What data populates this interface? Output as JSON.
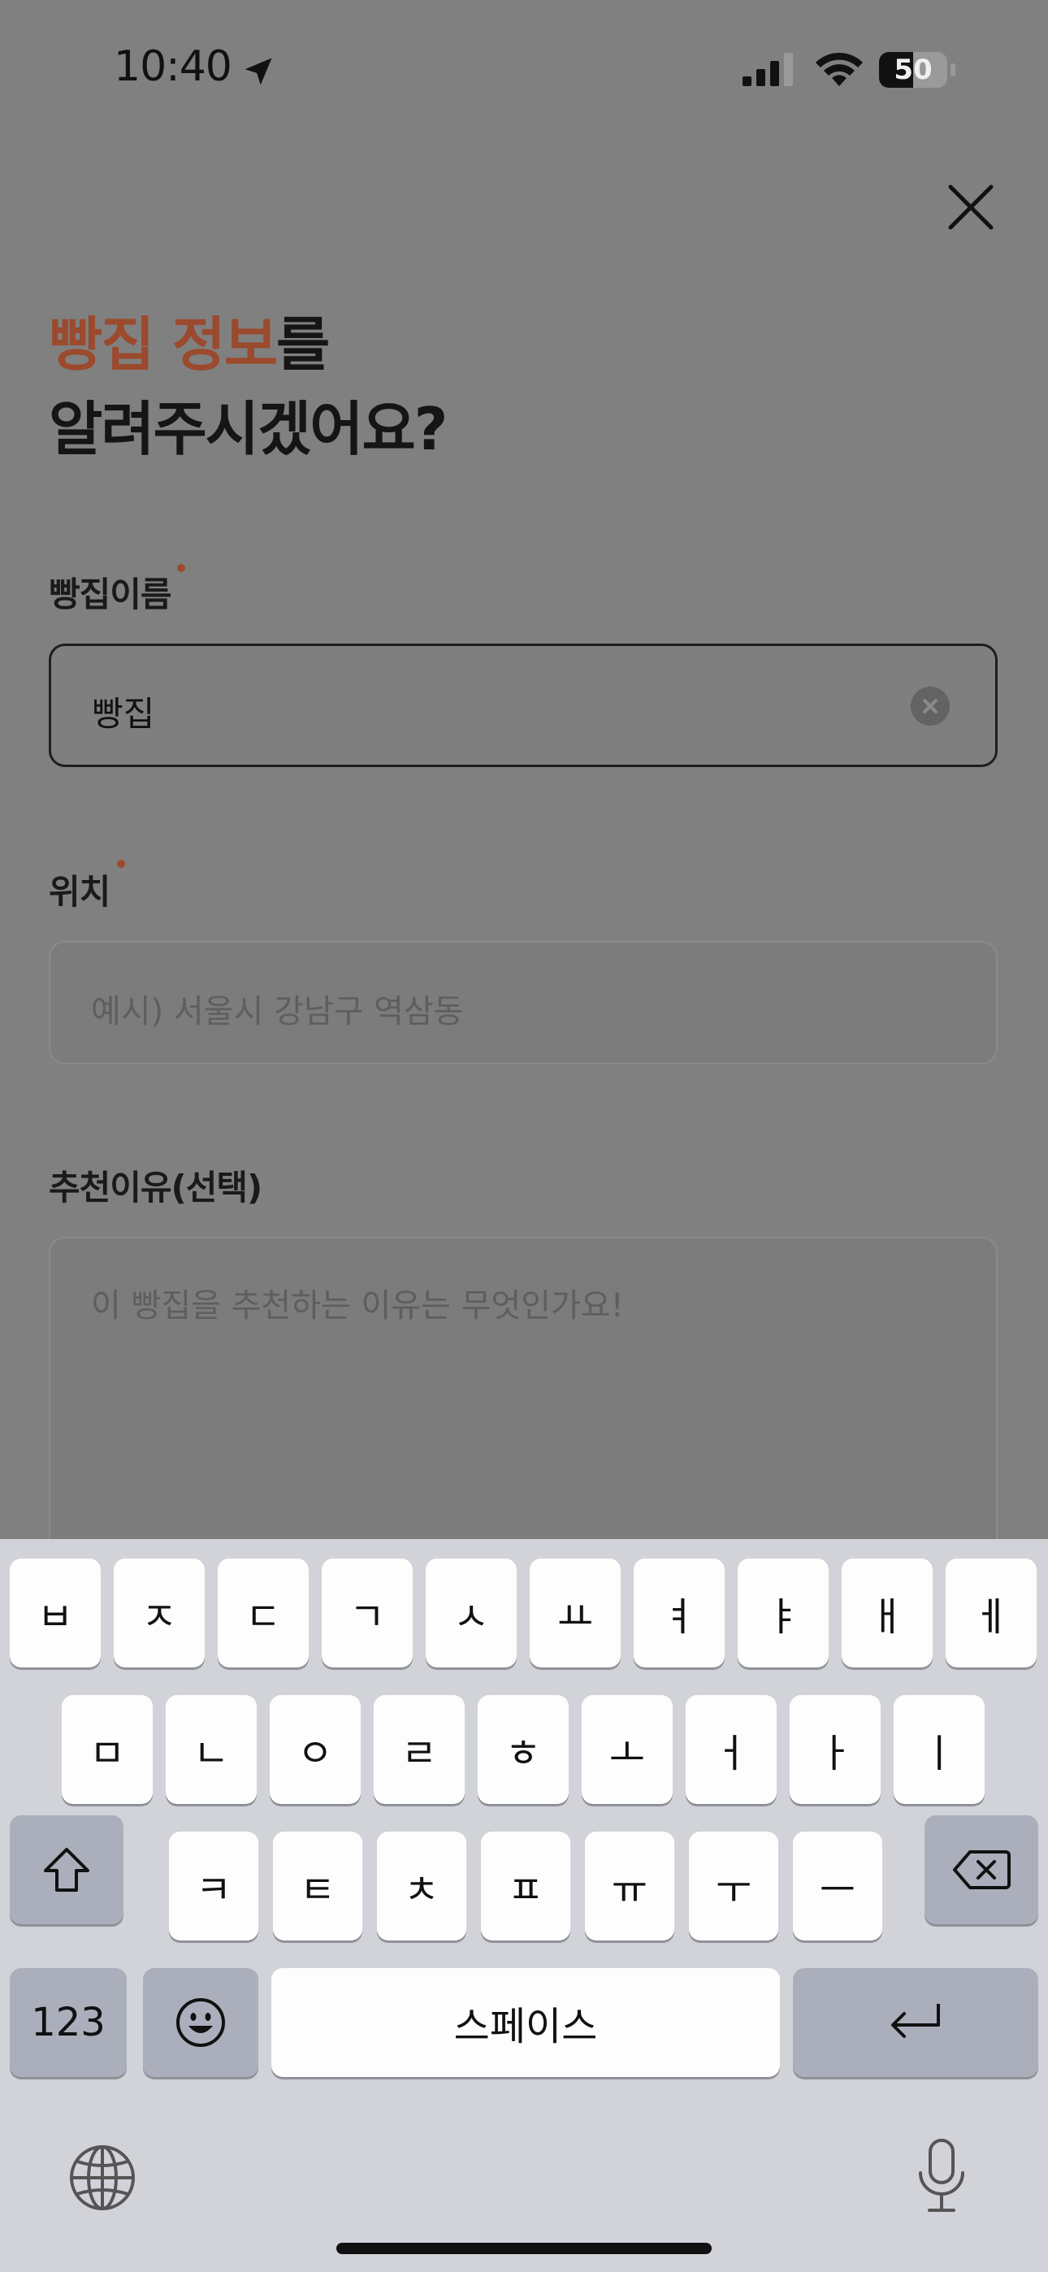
{
  "status_bar": {
    "time": "10:40",
    "battery": "50",
    "battery_level": 0.5
  },
  "header": {
    "title_accent": "빵집 정보",
    "title_rest": "를",
    "title_line2": "알려주시겠어요?"
  },
  "form": {
    "name": {
      "label": "빵집이름",
      "required": true,
      "value": "빵집"
    },
    "location": {
      "label": "위치",
      "required": true,
      "placeholder": "예시) 서울시 강남구 역삼동"
    },
    "reason": {
      "label": "추천이유(선택)",
      "required": false,
      "placeholder": "이 빵집을 추천하는 이유는 무엇인가요!"
    }
  },
  "keyboard": {
    "row1": [
      "ㅂ",
      "ㅈ",
      "ㄷ",
      "ㄱ",
      "ㅅ",
      "ㅛ",
      "ㅕ",
      "ㅑ",
      "ㅐ",
      "ㅔ"
    ],
    "row2": [
      "ㅁ",
      "ㄴ",
      "ㅇ",
      "ㄹ",
      "ㅎ",
      "ㅗ",
      "ㅓ",
      "ㅏ",
      "ㅣ"
    ],
    "row3": [
      "ㅋ",
      "ㅌ",
      "ㅊ",
      "ㅍ",
      "ㅠ",
      "ㅜ",
      "ㅡ"
    ],
    "numbers_label": "123",
    "space_label": "스페이스"
  },
  "colors": {
    "accent": "#9b4a2e"
  }
}
